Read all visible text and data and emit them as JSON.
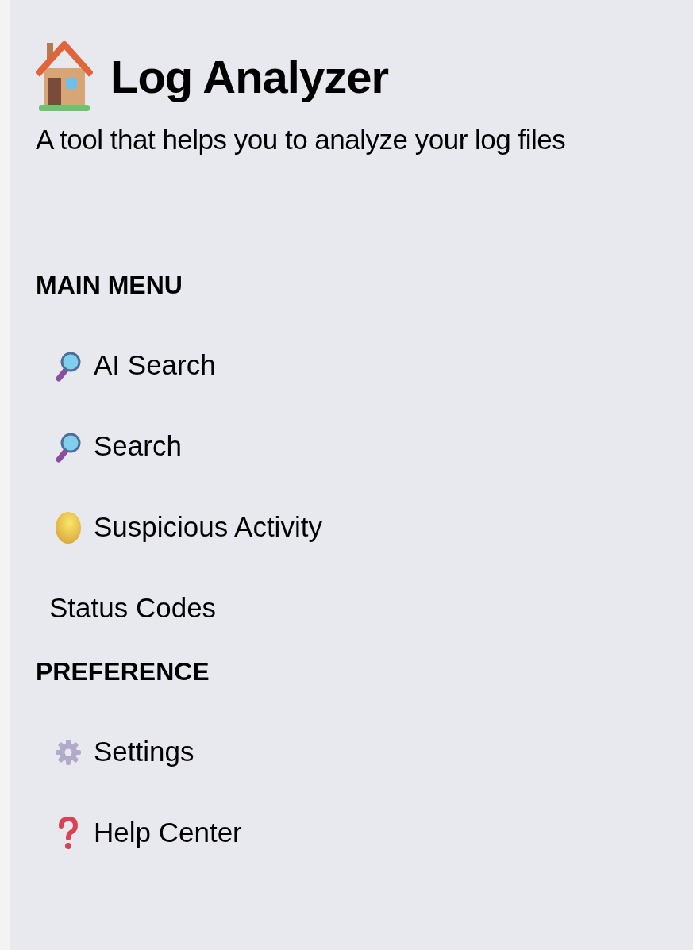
{
  "app": {
    "title": "Log Analyzer",
    "subtitle": "A tool that helps you to analyze your log files"
  },
  "sections": [
    {
      "heading": "MAIN MENU",
      "items": [
        {
          "label": "AI Search",
          "kind": "search"
        },
        {
          "label": "Search",
          "kind": "search"
        },
        {
          "label": "Suspicious Activity",
          "kind": "orb"
        },
        {
          "label": "Status Codes",
          "kind": "plain"
        }
      ]
    },
    {
      "heading": "PREFERENCE",
      "items": [
        {
          "label": "Settings",
          "kind": "gear"
        },
        {
          "label": "Help Center",
          "kind": "help"
        }
      ]
    }
  ]
}
